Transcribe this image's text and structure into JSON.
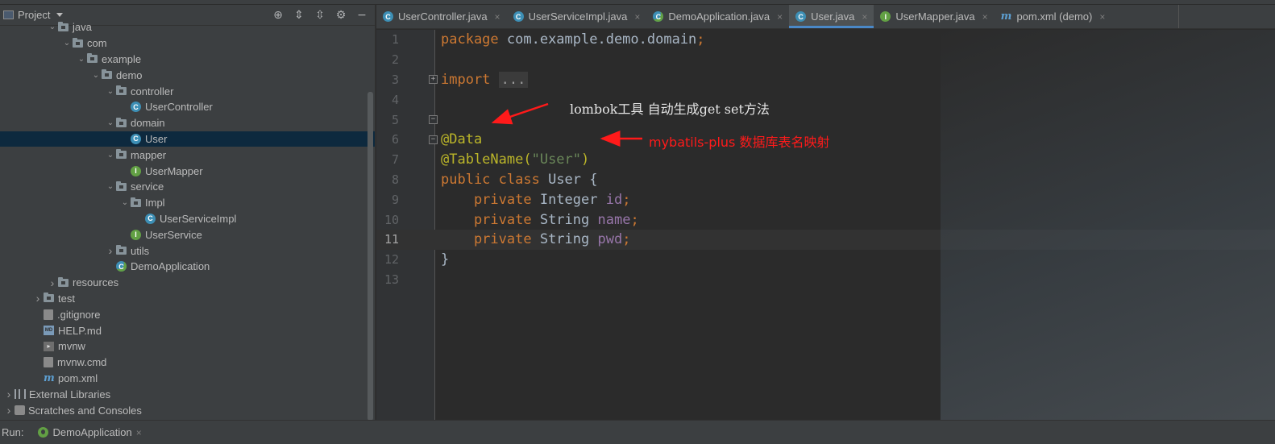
{
  "project_panel": {
    "title": "Project",
    "tools": [
      "locate-icon",
      "expand-all-icon",
      "collapse-all-icon",
      "gear-icon",
      "minimize-icon"
    ],
    "tree": [
      {
        "label": "java",
        "indent": 4,
        "icon": "folder",
        "expanded": true
      },
      {
        "label": "com",
        "indent": 5,
        "icon": "folder",
        "expanded": true
      },
      {
        "label": "example",
        "indent": 6,
        "icon": "folder",
        "expanded": true
      },
      {
        "label": "demo",
        "indent": 7,
        "icon": "folder",
        "expanded": true
      },
      {
        "label": "controller",
        "indent": 8,
        "icon": "folder",
        "expanded": true
      },
      {
        "label": "UserController",
        "indent": 9,
        "icon": "class"
      },
      {
        "label": "domain",
        "indent": 8,
        "icon": "folder",
        "expanded": true
      },
      {
        "label": "User",
        "indent": 9,
        "icon": "class",
        "selected": true
      },
      {
        "label": "mapper",
        "indent": 8,
        "icon": "folder",
        "expanded": true
      },
      {
        "label": "UserMapper",
        "indent": 9,
        "icon": "interface"
      },
      {
        "label": "service",
        "indent": 8,
        "icon": "folder",
        "expanded": true
      },
      {
        "label": "Impl",
        "indent": 9,
        "icon": "folder",
        "expanded": true
      },
      {
        "label": "UserServiceImpl",
        "indent": 10,
        "icon": "class"
      },
      {
        "label": "UserService",
        "indent": 9,
        "icon": "interface"
      },
      {
        "label": "utils",
        "indent": 8,
        "icon": "folder",
        "expanded": false
      },
      {
        "label": "DemoApplication",
        "indent": 8,
        "icon": "spring-class"
      },
      {
        "label": "resources",
        "indent": 4,
        "icon": "folder",
        "expanded": false
      },
      {
        "label": "test",
        "indent": 3,
        "icon": "folder",
        "expanded": false
      },
      {
        "label": ".gitignore",
        "indent": 3,
        "icon": "file"
      },
      {
        "label": "HELP.md",
        "indent": 3,
        "icon": "md"
      },
      {
        "label": "mvnw",
        "indent": 3,
        "icon": "mvn"
      },
      {
        "label": "mvnw.cmd",
        "indent": 3,
        "icon": "file"
      },
      {
        "label": "pom.xml",
        "indent": 3,
        "icon": "maven"
      },
      {
        "label": "External Libraries",
        "indent": 1,
        "icon": "library",
        "expanded": false
      },
      {
        "label": "Scratches and Consoles",
        "indent": 1,
        "icon": "scratch",
        "expanded": false
      }
    ]
  },
  "tabs": [
    {
      "label": "UserController.java",
      "icon": "class"
    },
    {
      "label": "UserServiceImpl.java",
      "icon": "class"
    },
    {
      "label": "DemoApplication.java",
      "icon": "spring-class"
    },
    {
      "label": "User.java",
      "icon": "class",
      "active": true
    },
    {
      "label": "UserMapper.java",
      "icon": "interface"
    },
    {
      "label": "pom.xml (demo)",
      "icon": "maven"
    }
  ],
  "editor": {
    "current_line": 11,
    "lines": [
      [
        {
          "t": "package ",
          "c": "kw"
        },
        {
          "t": "com.example.demo.domain",
          "c": ""
        },
        {
          "t": ";",
          "c": "kw"
        }
      ],
      [],
      [
        {
          "t": "import ",
          "c": "kw"
        },
        {
          "t": "...",
          "c": "folded"
        }
      ],
      [],
      [],
      [
        {
          "t": "@Data",
          "c": "ann"
        }
      ],
      [
        {
          "t": "@TableName(",
          "c": "ann"
        },
        {
          "t": "\"User\"",
          "c": "str"
        },
        {
          "t": ")",
          "c": "ann"
        }
      ],
      [
        {
          "t": "public ",
          "c": "kw"
        },
        {
          "t": "class ",
          "c": "kw"
        },
        {
          "t": "User {",
          "c": ""
        }
      ],
      [
        {
          "t": "    private ",
          "c": "kw"
        },
        {
          "t": "Integer ",
          "c": ""
        },
        {
          "t": "id",
          "c": "fld"
        },
        {
          "t": ";",
          "c": "kw"
        }
      ],
      [
        {
          "t": "    private ",
          "c": "kw"
        },
        {
          "t": "String ",
          "c": ""
        },
        {
          "t": "name",
          "c": "fld"
        },
        {
          "t": ";",
          "c": "kw"
        }
      ],
      [
        {
          "t": "    private ",
          "c": "kw"
        },
        {
          "t": "String ",
          "c": ""
        },
        {
          "t": "pwd",
          "c": "fld"
        },
        {
          "t": ";",
          "c": "kw"
        }
      ],
      [
        {
          "t": "}",
          "c": ""
        }
      ],
      []
    ],
    "annotations": {
      "lombok_note": "lombok工具 自动生成get set方法",
      "mybatis_note": "mybatils-plus 数据库表名映射",
      "arrow_color": "#ff1a1a"
    }
  },
  "run_bar": {
    "label": "Run:",
    "config": "DemoApplication"
  },
  "colors": {
    "keyword": "#cc7832",
    "annotation": "#bbb529",
    "string": "#6a8759",
    "field": "#9876aa",
    "selection": "#0d293e",
    "active_tab_underline": "#4a88c7"
  }
}
